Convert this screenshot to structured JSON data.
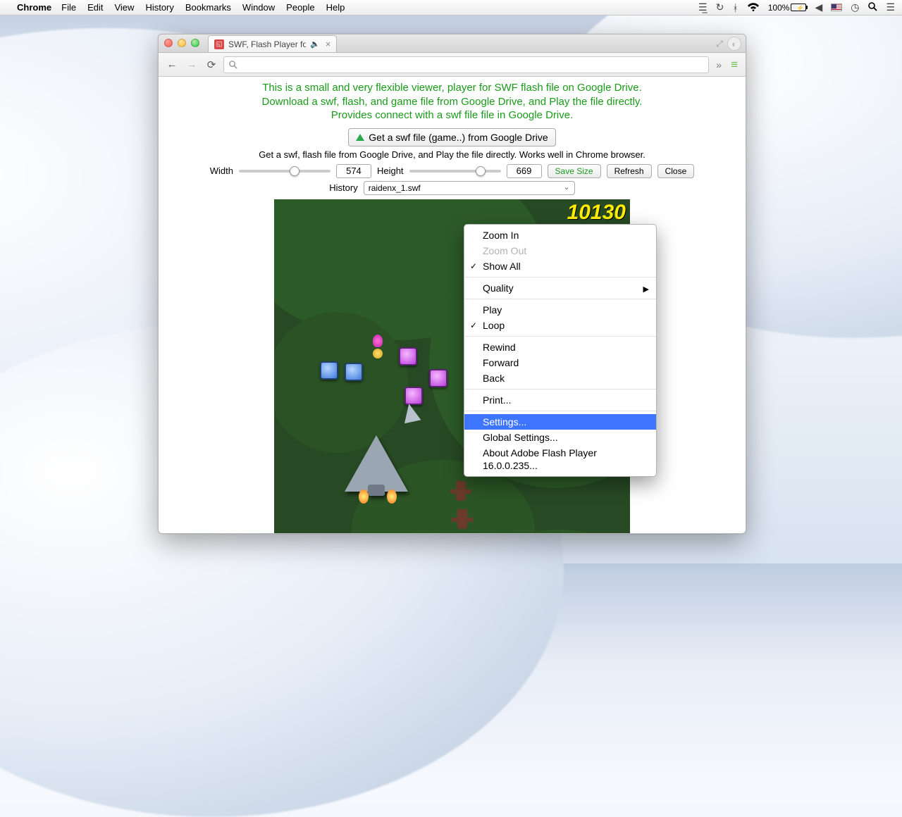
{
  "menubar": {
    "app": "Chrome",
    "items": [
      "File",
      "Edit",
      "View",
      "History",
      "Bookmarks",
      "Window",
      "People",
      "Help"
    ],
    "battery": "100%"
  },
  "tab": {
    "title": "SWF, Flash Player for Dr"
  },
  "page": {
    "line1": "This is a small and very flexible viewer, player for SWF flash file on Google Drive.",
    "line2": "Download a swf, flash, and game file from Google Drive, and Play the file directly.",
    "line3": "Provides connect with a swf file file in Google Drive.",
    "get_btn": "Get a swf file (game..) from Google Drive",
    "blurb": "Get a swf, flash file from Google Drive, and Play the file directly. Works well in Chrome browser.",
    "width_label": "Width",
    "width_value": "574",
    "height_label": "Height",
    "height_value": "669",
    "save_btn": "Save Size",
    "refresh_btn": "Refresh",
    "close_btn": "Close",
    "history_label": "History",
    "history_value": "raidenx_1.swf"
  },
  "game": {
    "score": "10130"
  },
  "ctx": {
    "zoom_in": "Zoom In",
    "zoom_out": "Zoom Out",
    "show_all": "Show All",
    "quality": "Quality",
    "play": "Play",
    "loop": "Loop",
    "rewind": "Rewind",
    "forward": "Forward",
    "back": "Back",
    "print": "Print...",
    "settings": "Settings...",
    "global": "Global Settings...",
    "about": "About Adobe Flash Player 16.0.0.235..."
  },
  "toolbar": {
    "chevrons": "»"
  }
}
